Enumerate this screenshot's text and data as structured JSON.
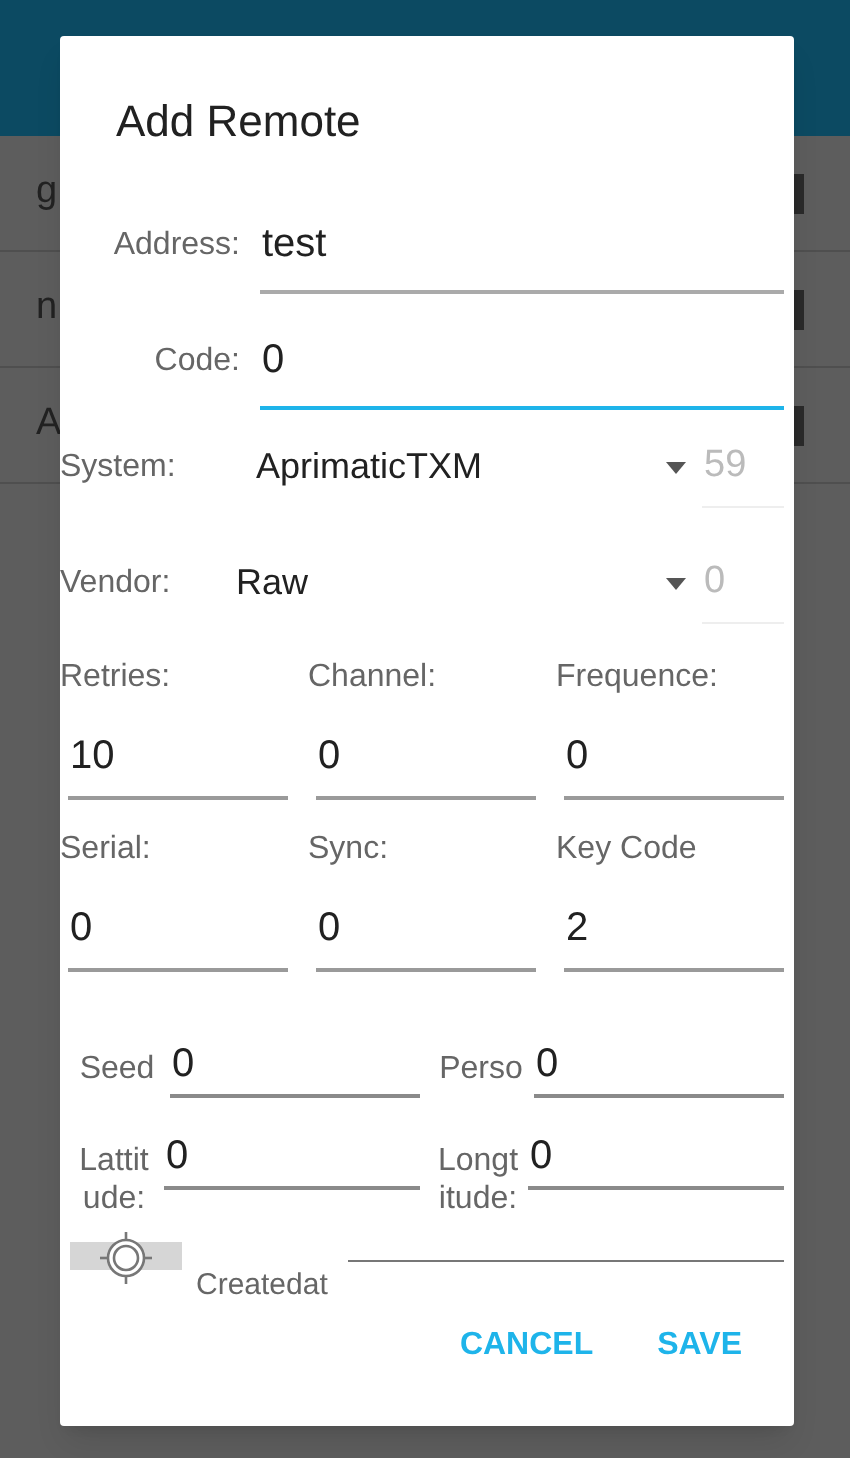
{
  "background": {
    "rows": [
      {
        "text": "g"
      },
      {
        "text": "n"
      },
      {
        "text": "A"
      }
    ]
  },
  "dialog": {
    "title": "Add Remote",
    "top_fields": [
      {
        "label": "Address:",
        "value": "test",
        "focused": false
      },
      {
        "label": "Code:",
        "value": "0",
        "focused": true
      }
    ],
    "spinners": [
      {
        "label": "System:",
        "value": "AprimaticTXM",
        "number": "59",
        "kind": "wide"
      },
      {
        "label": "Vendor:",
        "value": "Raw",
        "number": "0",
        "kind": "narrow"
      }
    ],
    "grid": [
      {
        "label": "Retries:",
        "value": "10"
      },
      {
        "label": "Channel:",
        "value": "0"
      },
      {
        "label": "Frequence:",
        "value": "0"
      },
      {
        "label": "Serial:",
        "value": "0"
      },
      {
        "label": "Sync:",
        "value": "0"
      },
      {
        "label": "Key Code",
        "value": "2"
      }
    ],
    "pairs": [
      [
        {
          "label": "Seed",
          "value": "0"
        },
        {
          "label": "Perso",
          "value": "0"
        }
      ],
      [
        {
          "label": "Lattitude:",
          "value": "0"
        },
        {
          "label": "Longtitude:",
          "value": "0"
        }
      ]
    ],
    "created_label": "Createdat",
    "buttons": [
      "CANCEL",
      "SAVE"
    ]
  }
}
